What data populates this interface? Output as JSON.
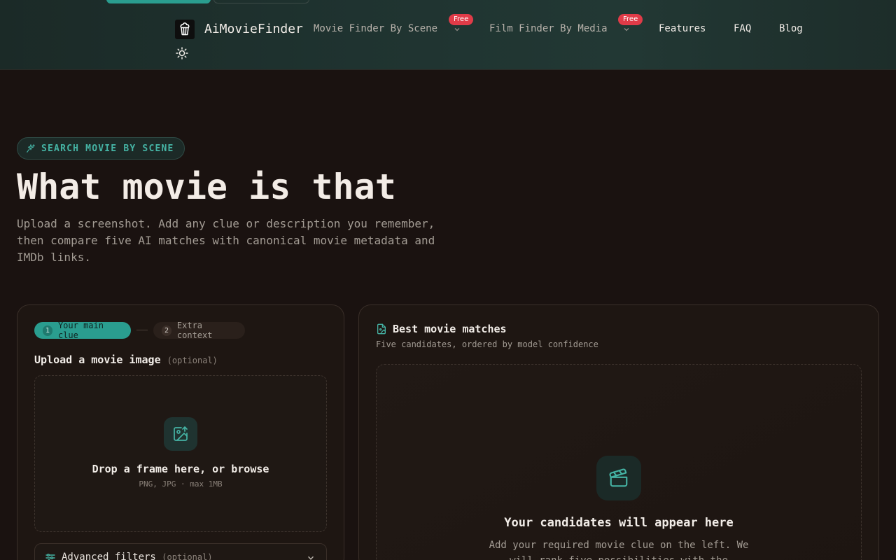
{
  "header": {
    "brand": "AiMovieFinder",
    "nav": [
      {
        "label": "Movie Finder By Scene",
        "badge": "Free"
      },
      {
        "label": "Film Finder By Media",
        "badge": "Free"
      },
      {
        "label": "Features"
      },
      {
        "label": "FAQ"
      },
      {
        "label": "Blog"
      }
    ],
    "icons": {
      "logo": "popcorn-icon",
      "theme": "sun-icon"
    }
  },
  "hero": {
    "pill": "SEARCH MOVIE BY SCENE",
    "title": "What movie is that",
    "subtitle": "Upload a screenshot. Add any clue or description you remember, then compare five AI matches with canonical movie metadata and IMDb links."
  },
  "form": {
    "steps": [
      {
        "num": "1",
        "label": "Your main clue"
      },
      {
        "num": "2",
        "label": "Extra context"
      }
    ],
    "upload_label": "Upload a movie image",
    "optional": "(optional)",
    "drop_title": "Drop a frame here, or browse",
    "drop_sub": "PNG, JPG · max 1MB",
    "advanced": "Advanced filters",
    "advanced_optional": "(optional)"
  },
  "results": {
    "title": "Best movie matches",
    "subtitle": "Five candidates, ordered by model confidence",
    "empty_title": "Your candidates will appear here",
    "empty_sub": "Add your required movie clue on the left. We will rank five possibilities with the"
  },
  "colors": {
    "accent": "#2a9d8f",
    "badge": "#e03b48",
    "background": "#1a1210"
  }
}
